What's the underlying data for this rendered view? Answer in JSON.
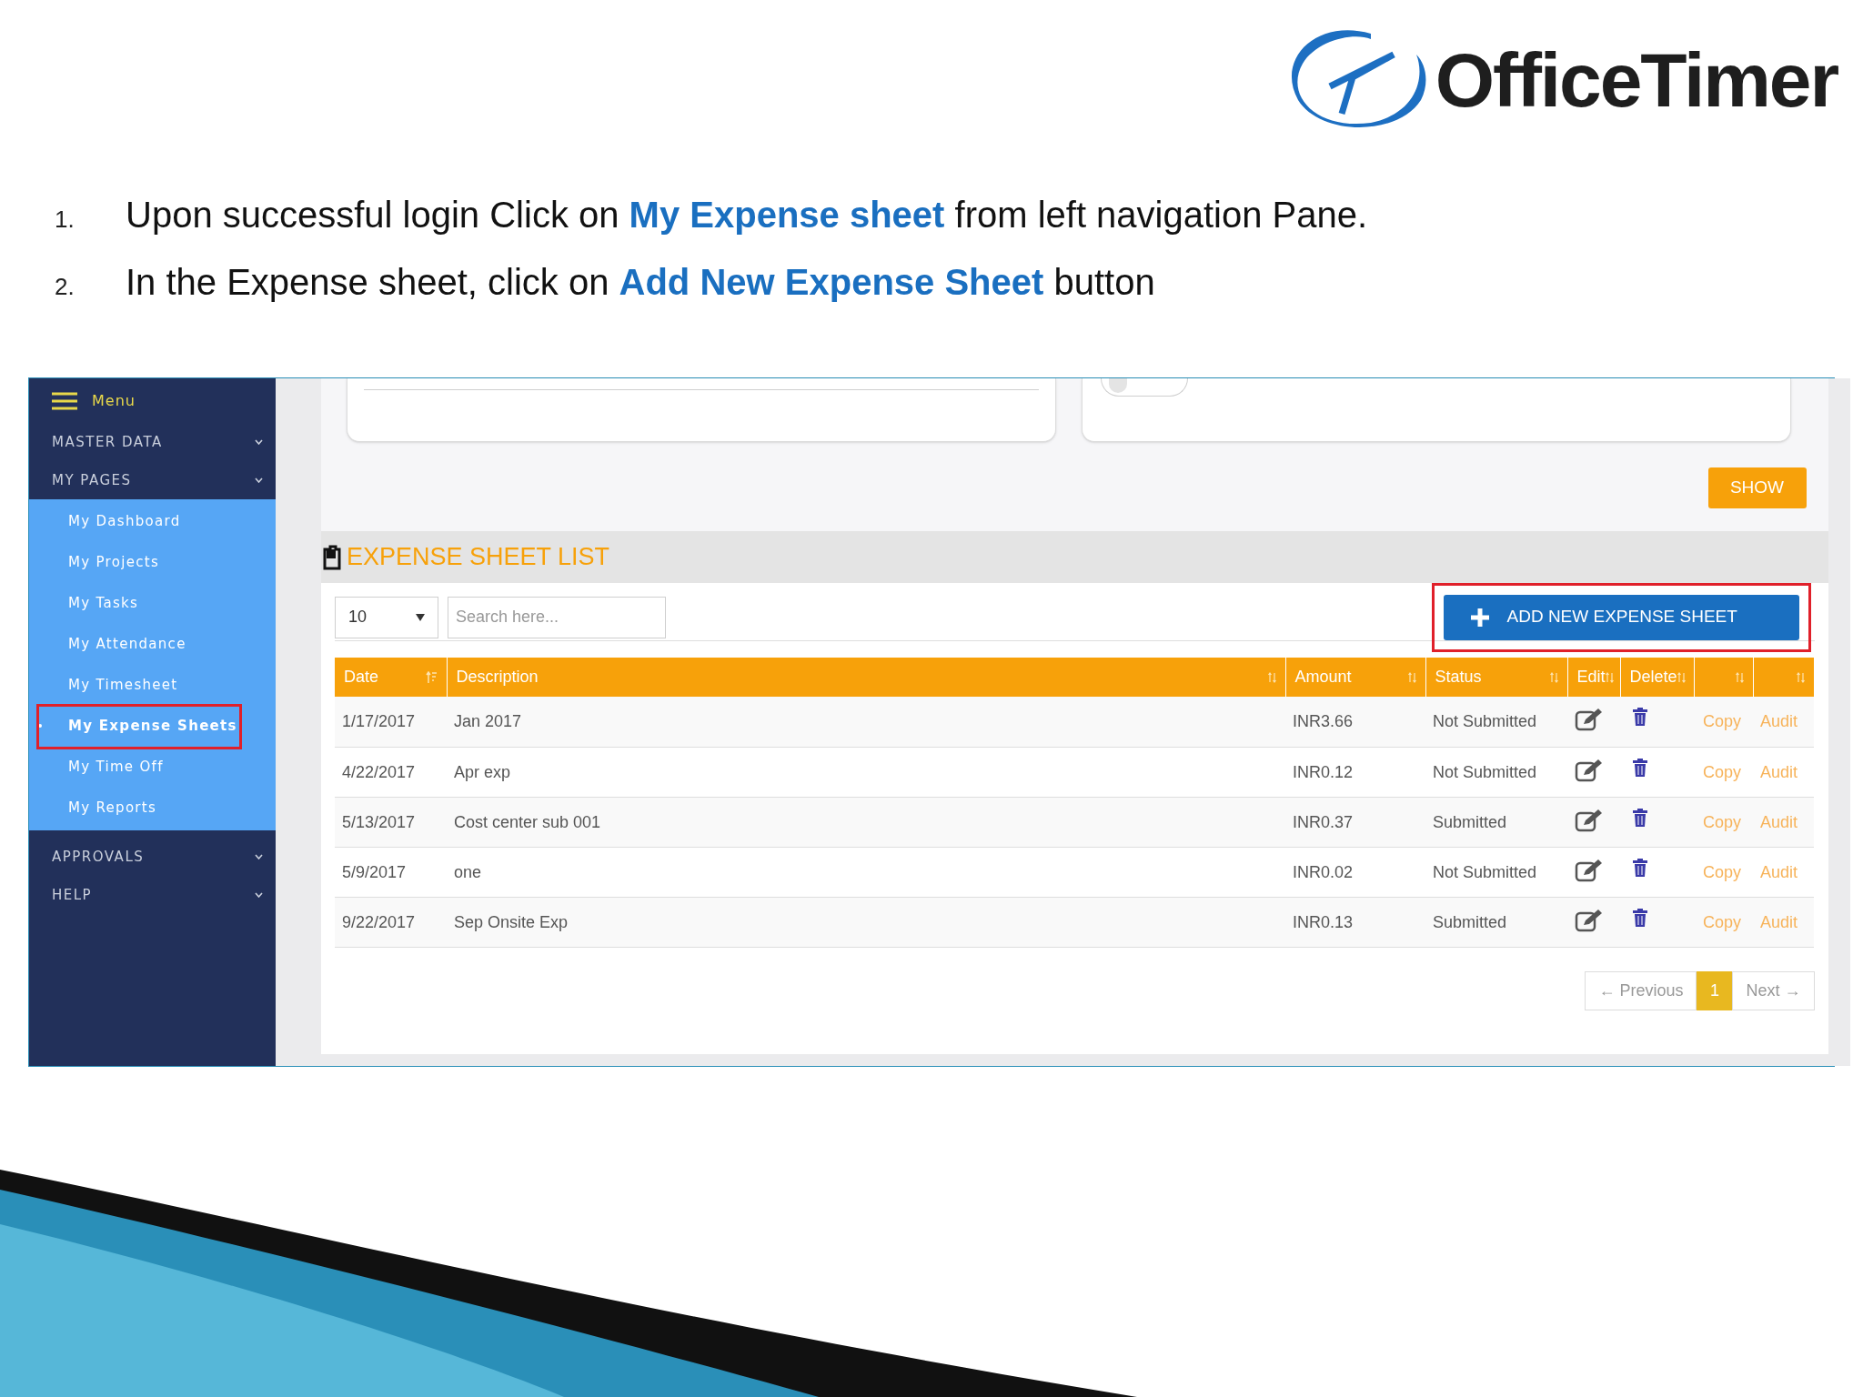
{
  "logo": {
    "text": "OfficeTimer"
  },
  "instructions": [
    {
      "number": "1.",
      "text": "Upon successful login Click on **My Expense sheet** from left navigation Pane."
    },
    {
      "number": "2.",
      "text": "In the Expense sheet, click on **Add New Expense Sheet** button"
    }
  ],
  "sidebar": {
    "menu_label": "Menu",
    "sections": [
      {
        "label": "MASTER DATA"
      },
      {
        "label": "MY PAGES",
        "items": [
          {
            "label": "My Dashboard",
            "selected": false,
            "highlighted": false
          },
          {
            "label": "My Projects",
            "selected": false,
            "highlighted": false
          },
          {
            "label": "My Tasks",
            "selected": false,
            "highlighted": false
          },
          {
            "label": "My Attendance",
            "selected": false,
            "highlighted": false
          },
          {
            "label": "My Timesheet",
            "selected": false,
            "highlighted": false
          },
          {
            "label": "My Expense Sheets",
            "selected": true,
            "highlighted": true
          },
          {
            "label": "My Time Off",
            "selected": false,
            "highlighted": false
          },
          {
            "label": "My Reports",
            "selected": false,
            "highlighted": false
          }
        ]
      },
      {
        "label": "APPROVALS"
      },
      {
        "label": "HELP"
      }
    ]
  },
  "filters": {
    "toggle": {
      "on": false
    },
    "show_button": "SHOW"
  },
  "list": {
    "title": "EXPENSE SHEET LIST",
    "page_size": "10",
    "search": {
      "placeholder": "Search here..."
    },
    "add_button": {
      "label": "ADD NEW EXPENSE SHEET",
      "highlighted": true
    },
    "columns": [
      {
        "label": "Date",
        "sorted": true
      },
      {
        "label": "Description",
        "sorted": false
      },
      {
        "label": "Amount",
        "sorted": false
      },
      {
        "label": "Status",
        "sorted": false
      },
      {
        "label": "Edit",
        "sorted": false
      },
      {
        "label": "Delete",
        "sorted": false
      },
      {
        "sorted": false
      },
      {
        "sorted": false
      }
    ],
    "rows": [
      {
        "date": "1/17/2017",
        "description": "Jan 2017",
        "amount": "INR3.66",
        "status": "Not Submitted",
        "copy": "Copy",
        "audit": "Audit"
      },
      {
        "date": "4/22/2017",
        "description": "Apr exp",
        "amount": "INR0.12",
        "status": "Not Submitted",
        "copy": "Copy",
        "audit": "Audit"
      },
      {
        "date": "5/13/2017",
        "description": "Cost center sub 001",
        "amount": "INR0.37",
        "status": "Submitted",
        "copy": "Copy",
        "audit": "Audit"
      },
      {
        "date": "5/9/2017",
        "description": "one",
        "amount": "INR0.02",
        "status": "Not Submitted",
        "copy": "Copy",
        "audit": "Audit"
      },
      {
        "date": "9/22/2017",
        "description": "Sep Onsite Exp",
        "amount": "INR0.13",
        "status": "Submitted",
        "copy": "Copy",
        "audit": "Audit"
      }
    ],
    "pagination": {
      "previous": "← Previous",
      "pages": [
        {
          "label": "1",
          "selected": true
        }
      ],
      "next": "Next →"
    }
  }
}
